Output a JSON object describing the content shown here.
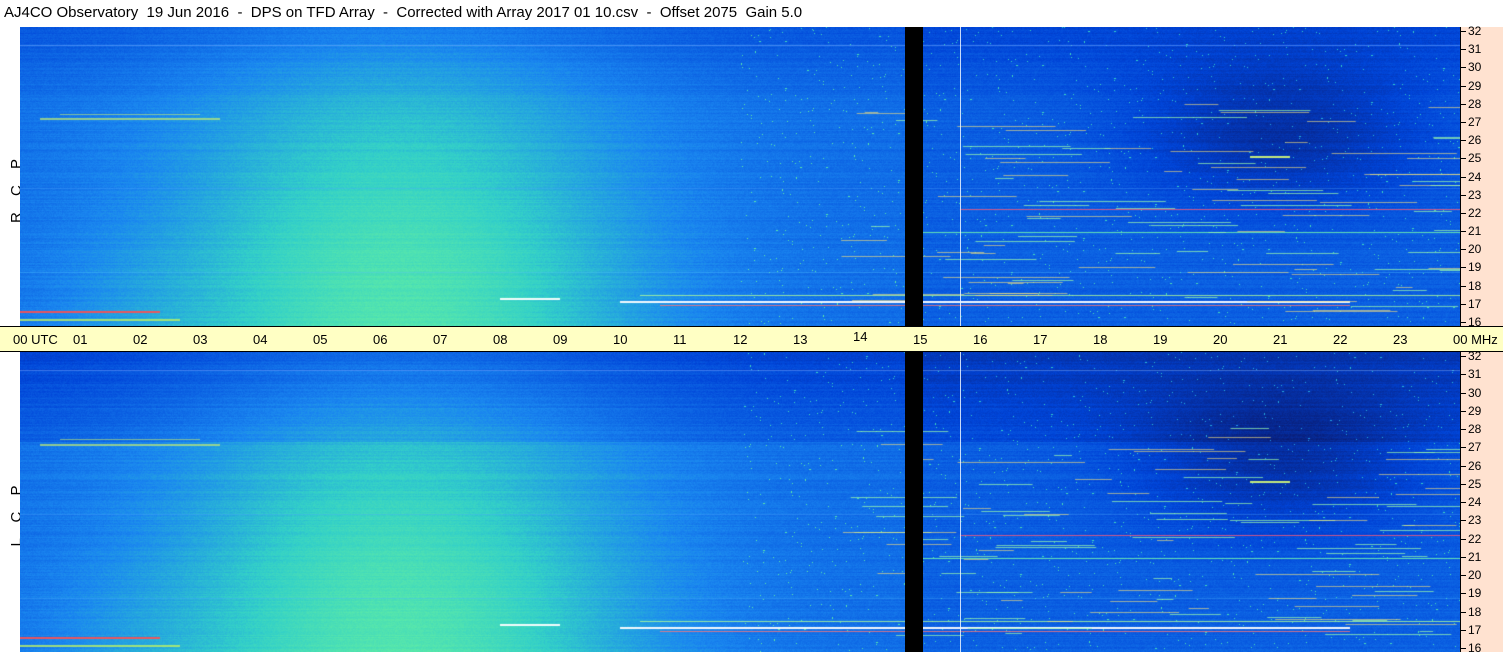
{
  "header": {
    "title": "AJ4CO Observatory  19 Jun 2016  -  DPS on TFD Array  -  Corrected with Array 2017 01 10.csv  -  Offset 2075  Gain 5.0"
  },
  "panels": {
    "top_label": "R C P",
    "bottom_label": "L C P"
  },
  "time_axis": {
    "labels": [
      "00 UTC",
      "01",
      "02",
      "03",
      "04",
      "05",
      "06",
      "07",
      "08",
      "09",
      "10",
      "11",
      "12",
      "13",
      "14",
      "15",
      "16",
      "17",
      "18",
      "19",
      "20",
      "21",
      "22",
      "23",
      "00 MHz"
    ]
  },
  "chart_data": {
    "type": "heatmap",
    "title": "AJ4CO Observatory  19 Jun 2016  -  DPS on TFD Array  -  Corrected with Array 2017 01 10.csv  -  Offset 2075  Gain 5.0",
    "x_unit": "UTC hour",
    "x_range": [
      0,
      24
    ],
    "y_unit": "MHz",
    "y_range": [
      16,
      32
    ],
    "y_ticks": [
      32,
      31,
      30,
      29,
      28,
      27,
      26,
      25,
      24,
      23,
      22,
      21,
      20,
      19,
      18,
      17,
      16
    ],
    "panels": [
      "R C P",
      "L C P"
    ],
    "data_gap_utc": [
      14.75,
      15.05
    ],
    "colormap": [
      "#0a1a6e",
      "#0044d8",
      "#1a86f0",
      "#33d0c8",
      "#66f0a0",
      "#c8f060",
      "#ff3030",
      "#ffffff"
    ]
  }
}
